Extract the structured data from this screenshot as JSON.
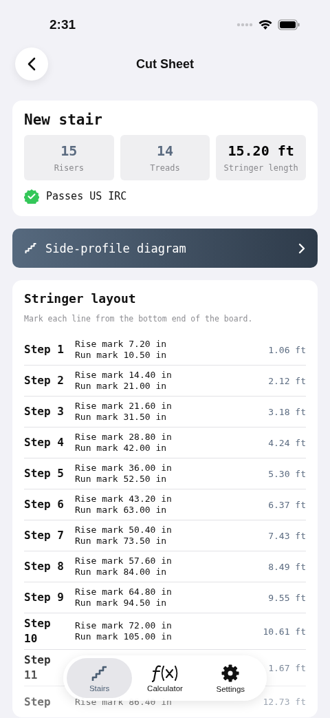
{
  "status_bar": {
    "time": "2:31"
  },
  "header": {
    "title": "Cut Sheet"
  },
  "summary": {
    "title": "New stair",
    "stats": [
      {
        "value": "15",
        "label": "Risers",
        "kind": "count"
      },
      {
        "value": "14",
        "label": "Treads",
        "kind": "count"
      },
      {
        "value": "15.20 ft",
        "label": "Stringer length",
        "kind": "length"
      }
    ],
    "compliance": {
      "passes": true,
      "text": "Passes US IRC"
    }
  },
  "diagram_button": {
    "label": "Side-profile diagram"
  },
  "stringer_layout": {
    "title": "Stringer layout",
    "note": "Mark each line from the bottom end of the board.",
    "steps": [
      {
        "step": "Step 1",
        "rise": "Rise mark 7.20 in",
        "run": "Run mark 10.50 in",
        "distance": "1.06 ft"
      },
      {
        "step": "Step 2",
        "rise": "Rise mark 14.40 in",
        "run": "Run mark 21.00 in",
        "distance": "2.12 ft"
      },
      {
        "step": "Step 3",
        "rise": "Rise mark 21.60 in",
        "run": "Run mark 31.50 in",
        "distance": "3.18 ft"
      },
      {
        "step": "Step 4",
        "rise": "Rise mark 28.80 in",
        "run": "Run mark 42.00 in",
        "distance": "4.24 ft"
      },
      {
        "step": "Step 5",
        "rise": "Rise mark 36.00 in",
        "run": "Run mark 52.50 in",
        "distance": "5.30 ft"
      },
      {
        "step": "Step 6",
        "rise": "Rise mark 43.20 in",
        "run": "Run mark 63.00 in",
        "distance": "6.37 ft"
      },
      {
        "step": "Step 7",
        "rise": "Rise mark 50.40 in",
        "run": "Run mark 73.50 in",
        "distance": "7.43 ft"
      },
      {
        "step": "Step 8",
        "rise": "Rise mark 57.60 in",
        "run": "Run mark 84.00 in",
        "distance": "8.49 ft"
      },
      {
        "step": "Step 9",
        "rise": "Rise mark 64.80 in",
        "run": "Run mark 94.50 in",
        "distance": "9.55 ft"
      },
      {
        "step": "Step 10",
        "rise": "Rise mark 72.00 in",
        "run": "Run mark 105.00 in",
        "distance": "10.61 ft"
      },
      {
        "step": "Step 11",
        "distance": "1.67 ft"
      },
      {
        "step": "Step",
        "rise": "Rise mark 86.40 in",
        "distance": "12.73 ft"
      }
    ]
  },
  "tab_bar": [
    {
      "label": "Stairs",
      "selected": true,
      "kind": "stairs"
    },
    {
      "label": "Calculator",
      "selected": false,
      "kind": "function"
    },
    {
      "label": "Settings",
      "selected": false,
      "kind": "gear"
    }
  ]
}
